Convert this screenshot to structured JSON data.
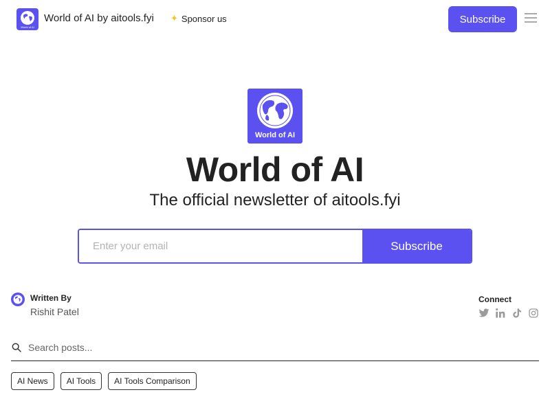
{
  "header": {
    "brand_title": "World of AI by aitools.fyi",
    "sponsor_label": "Sponsor us",
    "sponsor_icon": "star-icon",
    "subscribe_label": "Subscribe",
    "menu_icon": "hamburger-menu-icon"
  },
  "hero": {
    "logo_label": "World of AI",
    "title": "World of AI",
    "subtitle": "The official newsletter of aitools.fyi"
  },
  "signup": {
    "email_placeholder": "Enter your email",
    "email_value": "",
    "button_label": "Subscribe"
  },
  "author": {
    "label": "Written By",
    "name": "Rishit Patel"
  },
  "connect": {
    "label": "Connect",
    "links": [
      "twitter",
      "linkedin",
      "tiktok",
      "instagram"
    ]
  },
  "search": {
    "placeholder": "Search posts..."
  },
  "tags": [
    {
      "label": "AI News"
    },
    {
      "label": "AI Tools"
    },
    {
      "label": "AI Tools Comparison"
    }
  ],
  "colors": {
    "accent": "#5b51f0",
    "text": "#222222",
    "muted_icon": "#9a9a9a"
  }
}
